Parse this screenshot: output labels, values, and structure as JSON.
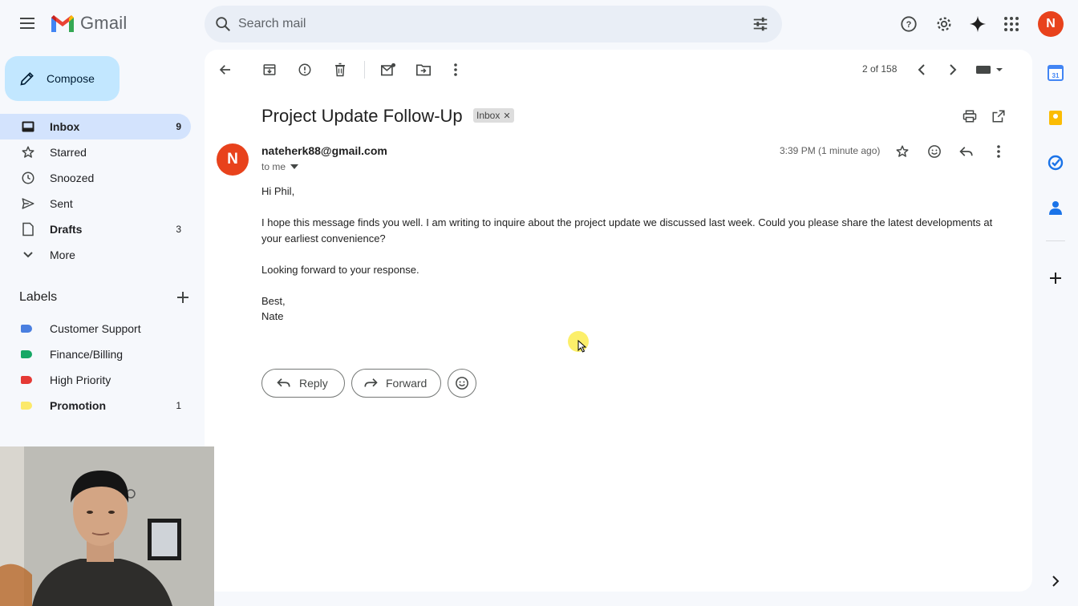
{
  "app": {
    "name": "Gmail"
  },
  "search": {
    "placeholder": "Search mail"
  },
  "account": {
    "initial": "N"
  },
  "compose": {
    "label": "Compose"
  },
  "nav": [
    {
      "label": "Inbox",
      "count": "9",
      "icon": "inbox-icon"
    },
    {
      "label": "Starred",
      "count": "",
      "icon": "star-icon"
    },
    {
      "label": "Snoozed",
      "count": "",
      "icon": "clock-icon"
    },
    {
      "label": "Sent",
      "count": "",
      "icon": "send-icon"
    },
    {
      "label": "Drafts",
      "count": "3",
      "icon": "draft-icon"
    },
    {
      "label": "More",
      "count": "",
      "icon": "chevron-down-icon"
    }
  ],
  "labels": {
    "heading": "Labels",
    "items": [
      {
        "name": "Customer Support",
        "count": "",
        "color": "#4a7fe0"
      },
      {
        "name": "Finance/Billing",
        "count": "",
        "color": "#16a765"
      },
      {
        "name": "High Priority",
        "count": "",
        "color": "#e53935"
      },
      {
        "name": "Promotion",
        "count": "1",
        "color": "#fce96a"
      }
    ]
  },
  "pager": {
    "text": "2 of 158"
  },
  "email": {
    "subject": "Project Update Follow-Up",
    "chip": "Inbox",
    "sender_initial": "N",
    "sender": "nateherk88@gmail.com",
    "to": "to me",
    "timestamp": "3:39 PM (1 minute ago)",
    "body": {
      "greeting": "Hi Phil,",
      "para1": "I hope this message finds you well. I am writing to inquire about the project update we discussed last week. Could you please share the latest developments at your earliest convenience?",
      "para2": "Looking forward to your response.",
      "signoff": "Best,",
      "name": "Nate"
    }
  },
  "actions": {
    "reply": "Reply",
    "forward": "Forward"
  },
  "colors": {
    "accent": "#0b57d0",
    "compose_bg": "#c2e7ff",
    "active_nav": "#d3e3fd",
    "avatar": "#e8421c"
  }
}
